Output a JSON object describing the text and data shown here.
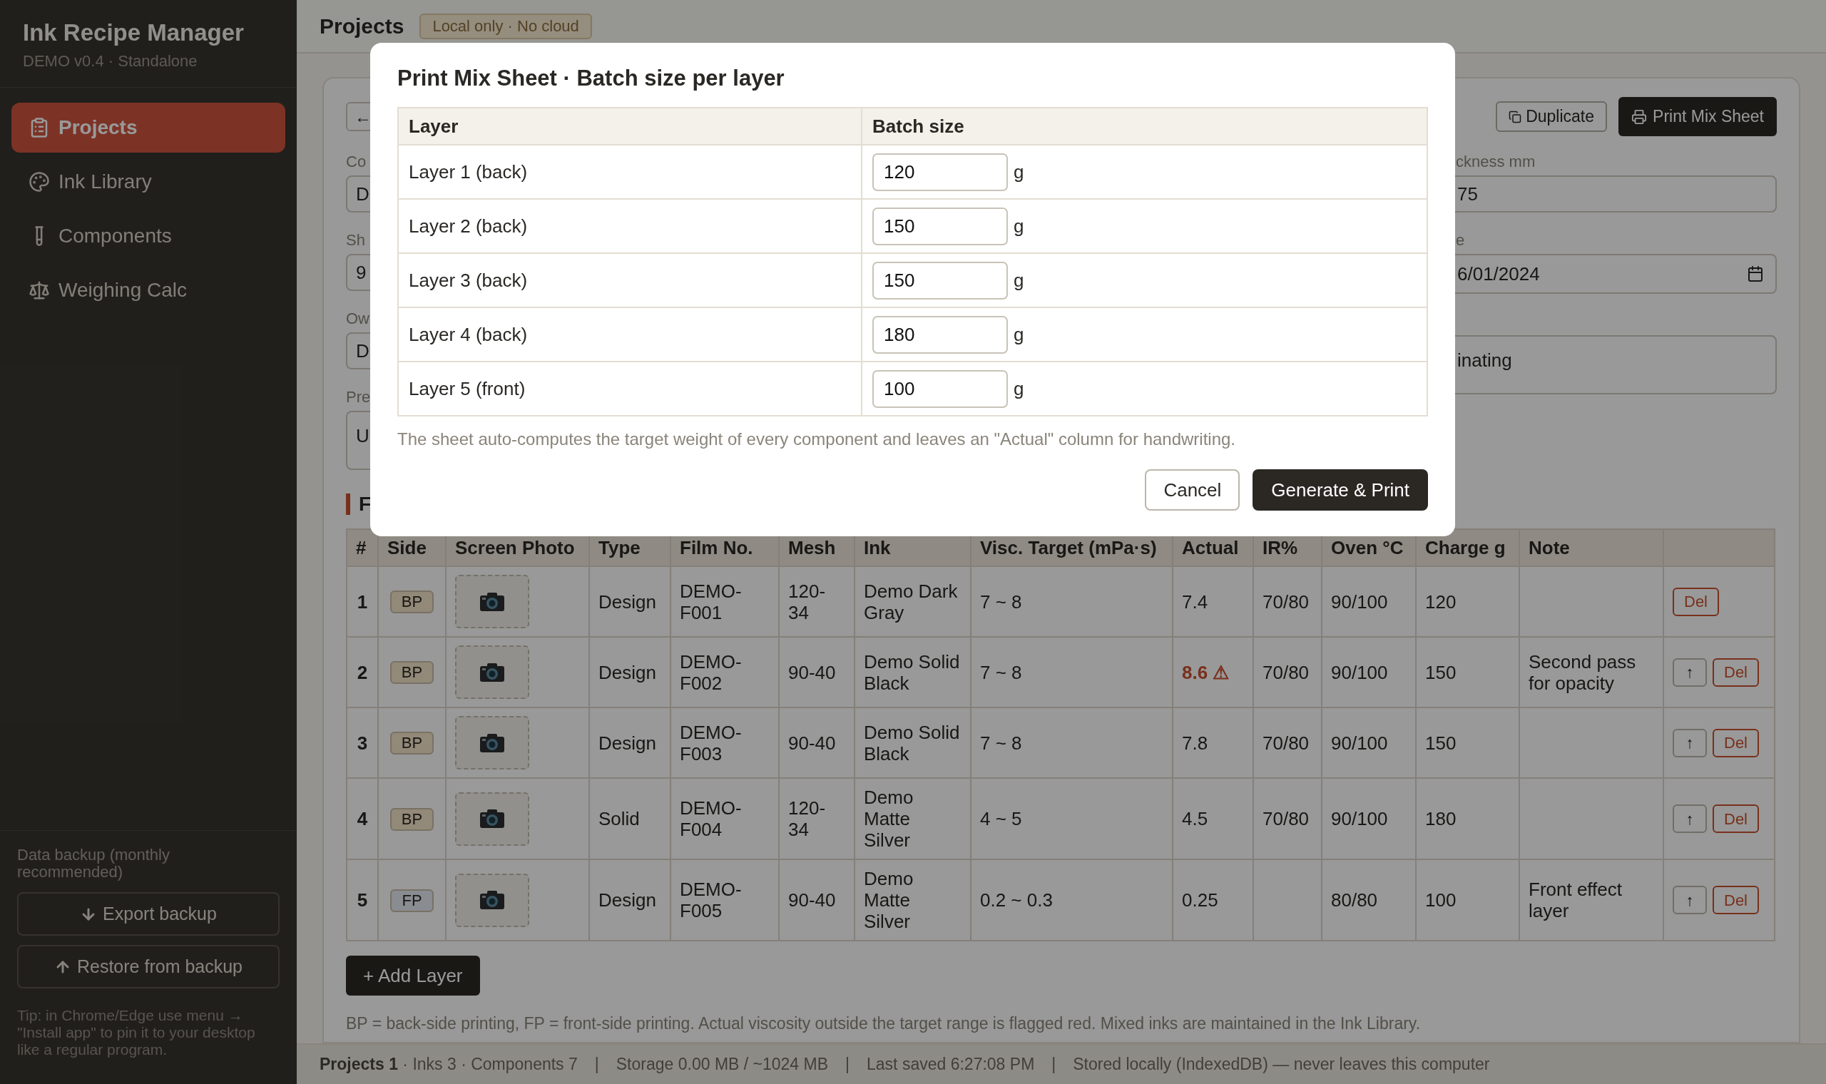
{
  "sidebar": {
    "title": "Ink Recipe Manager",
    "subtitle": "DEMO v0.4 · Standalone",
    "items": [
      {
        "label": "Projects",
        "selected": true
      },
      {
        "label": "Ink Library",
        "selected": false
      },
      {
        "label": "Components",
        "selected": false
      },
      {
        "label": "Weighing Calc",
        "selected": false
      }
    ],
    "backup_label": "Data backup (monthly recommended)",
    "export_button": "Export backup",
    "restore_button": "Restore from backup",
    "tip": "Tip: in Chrome/Edge use menu → \"Install app\" to pin it to your desktop like a regular program."
  },
  "header": {
    "title": "Projects",
    "badge": "Local only · No cloud"
  },
  "project": {
    "back_button": "←",
    "duplicate_button": "Duplicate",
    "print_button": "Print Mix Sheet",
    "left_fields": [
      {
        "label": "Co",
        "value": "D",
        "kind": "input"
      },
      {
        "label": "Sh",
        "value": "9",
        "kind": "input"
      },
      {
        "label": "Ow",
        "value": "D",
        "kind": "input"
      },
      {
        "label": "Pre",
        "value": "U",
        "kind": "textarea"
      }
    ],
    "right_fields": [
      {
        "label": "ckness mm",
        "value": "75",
        "kind": "input"
      },
      {
        "label": "e",
        "value": "6/01/2024",
        "kind": "date"
      },
      {
        "value": "inating",
        "kind": "textarea"
      }
    ],
    "section_title": "F",
    "table": {
      "columns": [
        "#",
        "Side",
        "Screen Photo",
        "Type",
        "Film No.",
        "Mesh",
        "Ink",
        "Visc. Target (mPa·s)",
        "Actual",
        "IR%",
        "Oven °C",
        "Charge g",
        "Note"
      ],
      "rows": [
        {
          "no": "1",
          "side": "BP",
          "color": "#928978",
          "type": "Design",
          "film": "DEMO-F001",
          "mesh": "120-34",
          "ink": "Demo Dark Gray",
          "visc": "7 ~ 8",
          "actual": "7.4",
          "flagged": false,
          "ir": "70/80",
          "oven": "90/100",
          "charge": "120",
          "note": "",
          "actions": [
            {
              "kind": "delete",
              "label": "Del"
            }
          ]
        },
        {
          "no": "2",
          "side": "BP",
          "color": "#928978",
          "type": "Design",
          "film": "DEMO-F002",
          "mesh": "90-40",
          "ink": "Demo Solid Black",
          "visc": "7 ~ 8",
          "actual": "8.6 ⚠",
          "flagged": true,
          "ir": "70/80",
          "oven": "90/100",
          "charge": "150",
          "note": "Second pass for opacity",
          "actions": [
            {
              "kind": "move",
              "label": "↑"
            },
            {
              "kind": "delete",
              "label": "Del"
            }
          ]
        },
        {
          "no": "3",
          "side": "BP",
          "color": "#928978",
          "type": "Design",
          "film": "DEMO-F003",
          "mesh": "90-40",
          "ink": "Demo Solid Black",
          "visc": "7 ~ 8",
          "actual": "7.8",
          "flagged": false,
          "ir": "70/80",
          "oven": "90/100",
          "charge": "150",
          "note": "",
          "actions": [
            {
              "kind": "move",
              "label": "↑"
            },
            {
              "kind": "delete",
              "label": "Del"
            }
          ]
        },
        {
          "no": "4",
          "side": "BP",
          "color": "#928978",
          "type": "Solid",
          "film": "DEMO-F004",
          "mesh": "120-34",
          "ink": "Demo Matte Silver",
          "visc": "4 ~ 5",
          "actual": "4.5",
          "flagged": false,
          "ir": "70/80",
          "oven": "90/100",
          "charge": "180",
          "note": "",
          "actions": [
            {
              "kind": "move",
              "label": "↑"
            },
            {
              "kind": "delete",
              "label": "Del"
            }
          ]
        },
        {
          "no": "5",
          "side": "FP",
          "color": "#898c90",
          "type": "Design",
          "film": "DEMO-F005",
          "mesh": "90-40",
          "ink": "Demo Matte Silver",
          "visc": "0.2 ~ 0.3",
          "actual": "0.25",
          "flagged": false,
          "ir": "",
          "oven": "80/80",
          "charge": "100",
          "note": "Front effect layer",
          "actions": [
            {
              "kind": "move",
              "label": "↑"
            },
            {
              "kind": "delete",
              "label": "Del"
            }
          ]
        }
      ]
    },
    "add_button": "+ Add Layer",
    "footnote": "BP = back-side printing, FP = front-side printing. Actual viscosity outside the target range is flagged red. Mixed inks are maintained in the Ink Library."
  },
  "status_bar": [
    {
      "kind": "text",
      "text": "**Projects 1** · Inks 3 · Components 7"
    },
    {
      "kind": "separator",
      "text": "|"
    },
    {
      "kind": "text",
      "text": "Storage 0.00 MB / ~1024 MB"
    },
    {
      "kind": "separator",
      "text": "|"
    },
    {
      "kind": "text",
      "text": "Last saved 6:27:08 PM"
    },
    {
      "kind": "separator",
      "text": "|"
    },
    {
      "kind": "text",
      "text": "Stored locally (IndexedDB) — never leaves this computer"
    }
  ],
  "dialog": {
    "title": "Print Mix Sheet · Batch size per layer",
    "columns": [
      "Layer",
      "Batch size"
    ],
    "rows": [
      {
        "layer": "Layer 1 (back)",
        "value": "120",
        "unit": "g"
      },
      {
        "layer": "Layer 2 (back)",
        "value": "150",
        "unit": "g"
      },
      {
        "layer": "Layer 3 (back)",
        "value": "150",
        "unit": "g"
      },
      {
        "layer": "Layer 4 (back)",
        "value": "180",
        "unit": "g"
      },
      {
        "layer": "Layer 5 (front)",
        "value": "100",
        "unit": "g"
      }
    ],
    "note": "The sheet auto-computes the target weight of every component and leaves an \"Actual\" column for handwriting.",
    "cancel_button": "Cancel",
    "confirm_button": "Generate & Print"
  }
}
